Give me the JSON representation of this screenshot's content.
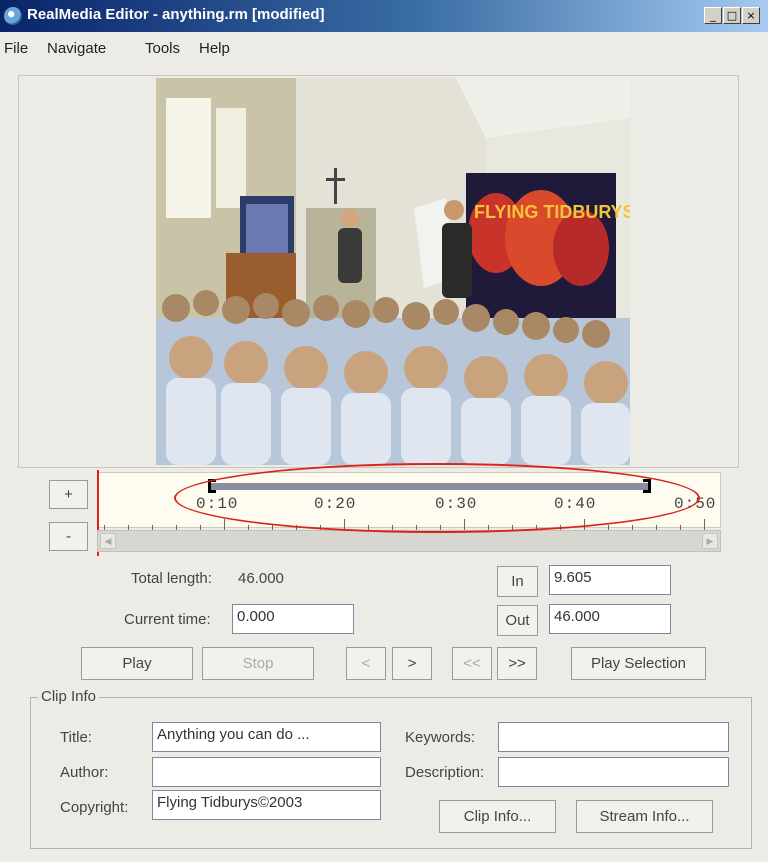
{
  "window": {
    "title": "RealMedia Editor - anything.rm [modified]",
    "controls": {
      "minimize": "_",
      "maximize": "□",
      "close": "×"
    }
  },
  "menu": [
    "File",
    "Navigate",
    "Tools",
    "Help"
  ],
  "zoom": {
    "plus": "+",
    "minus": "-"
  },
  "timeline": {
    "tick_labels": [
      "0:10",
      "0:20",
      "0:30",
      "0:40",
      "0:50"
    ],
    "selection_start_seconds": 9.605,
    "selection_end_seconds": 46.0
  },
  "times": {
    "total_length_label": "Total length:",
    "total_length_value": "46.000",
    "current_time_label": "Current time:",
    "current_time_value": "0.000"
  },
  "markers": {
    "in_label": "In",
    "in_value": "9.605",
    "out_label": "Out",
    "out_value": "46.000"
  },
  "transport": {
    "play": "Play",
    "stop": "Stop",
    "prev": "<",
    "next": ">",
    "rewind": "<<",
    "forward": ">>",
    "play_selection": "Play Selection"
  },
  "clip_info": {
    "group_title": "Clip Info",
    "title_label": "Title:",
    "title_value": "Anything you can do ...",
    "author_label": "Author:",
    "author_value": "",
    "copyright_label": "Copyright:",
    "copyright_value": "Flying Tidburys©2003",
    "keywords_label": "Keywords:",
    "keywords_value": "",
    "description_label": "Description:",
    "description_value": "",
    "clip_info_button": "Clip Info...",
    "stream_info_button": "Stream Info..."
  },
  "video": {
    "banner_text": "FLYING TIDBURYS SHOW"
  }
}
